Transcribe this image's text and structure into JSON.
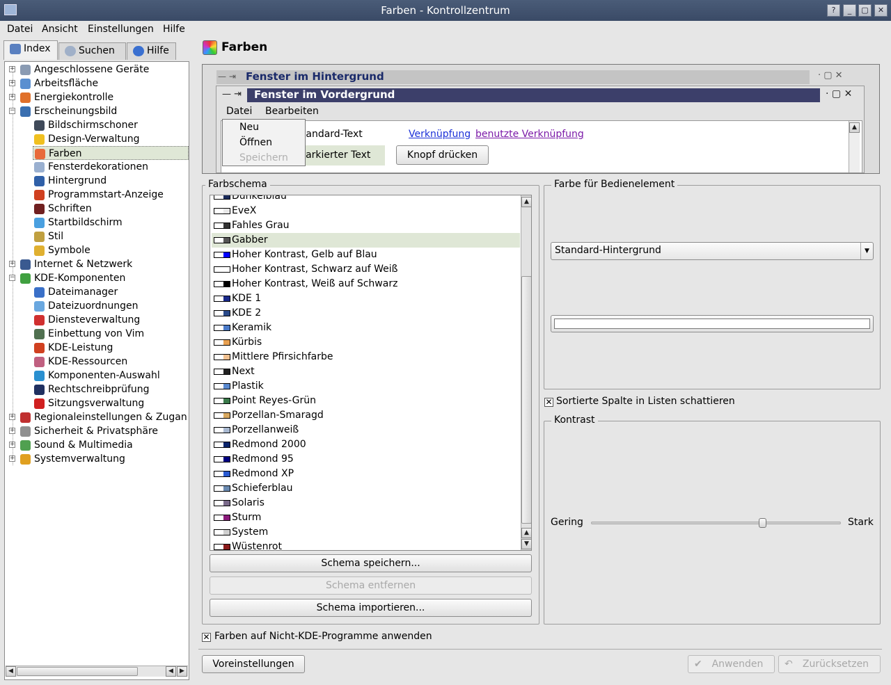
{
  "window": {
    "title": "Farben - Kontrollzentrum",
    "buttons": [
      "?",
      "_",
      "▢",
      "✕"
    ]
  },
  "menubar": [
    {
      "label": "Datei"
    },
    {
      "label": "Ansicht"
    },
    {
      "label": "Einstellungen"
    },
    {
      "label": "Hilfe"
    }
  ],
  "tabs": [
    {
      "label": "Index"
    },
    {
      "label": "Suchen"
    },
    {
      "label": "Hilfe"
    }
  ],
  "tree": [
    {
      "label": "Angeschlossene Geräte",
      "level": 0,
      "expander": "+",
      "icon_color": "#8a9bb3"
    },
    {
      "label": "Arbeitsfläche",
      "level": 0,
      "expander": "+",
      "icon_color": "#5a8fd0"
    },
    {
      "label": "Energiekontrolle",
      "level": 0,
      "expander": "+",
      "icon_color": "#e0702a"
    },
    {
      "label": "Erscheinungsbild",
      "level": 0,
      "expander": "−",
      "icon_color": "#3a6fb0"
    },
    {
      "label": "Bildschirmschoner",
      "level": 1,
      "icon_color": "#404a5a"
    },
    {
      "label": "Design-Verwaltung",
      "level": 1,
      "icon_color": "#f0c020"
    },
    {
      "label": "Farben",
      "level": 1,
      "icon_color": "#e86a3a",
      "selected": true
    },
    {
      "label": "Fensterdekorationen",
      "level": 1,
      "icon_color": "#9ab0d0"
    },
    {
      "label": "Hintergrund",
      "level": 1,
      "icon_color": "#3060a8"
    },
    {
      "label": "Programmstart-Anzeige",
      "level": 1,
      "icon_color": "#d04020"
    },
    {
      "label": "Schriften",
      "level": 1,
      "icon_color": "#702020"
    },
    {
      "label": "Startbildschirm",
      "level": 1,
      "icon_color": "#4aa0e0"
    },
    {
      "label": "Stil",
      "level": 1,
      "icon_color": "#c0a040"
    },
    {
      "label": "Symbole",
      "level": 1,
      "icon_color": "#e0b030"
    },
    {
      "label": "Internet & Netzwerk",
      "level": 0,
      "expander": "+",
      "icon_color": "#3a5a90"
    },
    {
      "label": "KDE-Komponenten",
      "level": 0,
      "expander": "−",
      "icon_color": "#40a040"
    },
    {
      "label": "Dateimanager",
      "level": 1,
      "icon_color": "#3a70c8"
    },
    {
      "label": "Dateizuordnungen",
      "level": 1,
      "icon_color": "#6aa8e0"
    },
    {
      "label": "Diensteverwaltung",
      "level": 1,
      "icon_color": "#d03030"
    },
    {
      "label": "Einbettung von Vim",
      "level": 1,
      "icon_color": "#507050"
    },
    {
      "label": "KDE-Leistung",
      "level": 1,
      "icon_color": "#d04020"
    },
    {
      "label": "KDE-Ressourcen",
      "level": 1,
      "icon_color": "#c06080"
    },
    {
      "label": "Komponenten-Auswahl",
      "level": 1,
      "icon_color": "#2a90d0"
    },
    {
      "label": "Rechtschreibprüfung",
      "level": 1,
      "icon_color": "#203060"
    },
    {
      "label": "Sitzungsverwaltung",
      "level": 1,
      "icon_color": "#d02020"
    },
    {
      "label": "Regionaleinstellungen & Zugan",
      "level": 0,
      "expander": "+",
      "icon_color": "#c03030"
    },
    {
      "label": "Sicherheit & Privatsphäre",
      "level": 0,
      "expander": "+",
      "icon_color": "#909090"
    },
    {
      "label": "Sound & Multimedia",
      "level": 0,
      "expander": "+",
      "icon_color": "#50a050"
    },
    {
      "label": "Systemverwaltung",
      "level": 0,
      "expander": "+",
      "icon_color": "#e0a020"
    }
  ],
  "page": {
    "title": "Farben"
  },
  "preview": {
    "inactive_title": "Fenster im Hintergrund",
    "active_title": "Fenster im Vordergrund",
    "menu": [
      "Datei",
      "Bearbeiten"
    ],
    "popup": [
      {
        "label": "Neu"
      },
      {
        "label": "Öffnen"
      },
      {
        "label": "Speichern",
        "disabled": true
      }
    ],
    "standard_text": "Standard-Text",
    "selected_text": "Markierter Text",
    "link": "Verknüpfung",
    "visited_link": "benutzte Verknüpfung",
    "button": "Knopf drücken"
  },
  "scheme_group": {
    "title": "Farbschema",
    "items": [
      {
        "label": "Dunkelblau",
        "swatch": "#1a2a5a"
      },
      {
        "label": "EveX",
        "swatch": "#e8e8e8"
      },
      {
        "label": "Fahles Grau",
        "swatch": "#333333"
      },
      {
        "label": "Gabber",
        "swatch": "#555555",
        "selected": true
      },
      {
        "label": "Hoher Kontrast, Gelb auf Blau",
        "swatch": "#0000ff"
      },
      {
        "label": "Hoher Kontrast, Schwarz auf Weiß",
        "swatch": "#ffffff"
      },
      {
        "label": "Hoher Kontrast, Weiß auf Schwarz",
        "swatch": "#000000"
      },
      {
        "label": "KDE 1",
        "swatch": "#1a2a8a"
      },
      {
        "label": "KDE 2",
        "swatch": "#2a4a8a"
      },
      {
        "label": "Keramik",
        "swatch": "#4a7ac8"
      },
      {
        "label": "Kürbis",
        "swatch": "#e8a050"
      },
      {
        "label": "Mittlere Pfirsichfarbe",
        "swatch": "#f0c090"
      },
      {
        "label": "Next",
        "swatch": "#222222"
      },
      {
        "label": "Plastik",
        "swatch": "#5a8ad0"
      },
      {
        "label": "Point Reyes-Grün",
        "swatch": "#3a7a4a"
      },
      {
        "label": "Porzellan-Smaragd",
        "swatch": "#d8a860"
      },
      {
        "label": "Porzellanweiß",
        "swatch": "#a8b8d0"
      },
      {
        "label": "Redmond 2000",
        "swatch": "#0a246a"
      },
      {
        "label": "Redmond 95",
        "swatch": "#000080"
      },
      {
        "label": "Redmond XP",
        "swatch": "#2a5ad0"
      },
      {
        "label": "Schieferblau",
        "swatch": "#6a8ab0"
      },
      {
        "label": "Solaris",
        "swatch": "#7a6a8a"
      },
      {
        "label": "Sturm",
        "swatch": "#8a1a7a"
      },
      {
        "label": "System",
        "swatch": "#d0d0d0"
      },
      {
        "label": "Wüstenrot",
        "swatch": "#8a1a1a"
      }
    ],
    "buttons": {
      "save": "Schema speichern...",
      "remove": "Schema entfernen",
      "import": "Schema importieren..."
    }
  },
  "element_group": {
    "title": "Farbe für Bedienelement",
    "selected_element": "Standard-Hintergrund"
  },
  "shade_checkbox": {
    "label": "Sortierte Spalte in Listen schattieren",
    "checked": true
  },
  "contrast_group": {
    "title": "Kontrast",
    "low_label": "Gering",
    "high_label": "Stark",
    "value_fraction": 0.69
  },
  "apply_nonkde": {
    "label": "Farben auf Nicht-KDE-Programme anwenden",
    "checked": true
  },
  "footer": {
    "defaults": "Voreinstellungen",
    "apply": "Anwenden",
    "reset": "Zurücksetzen"
  }
}
